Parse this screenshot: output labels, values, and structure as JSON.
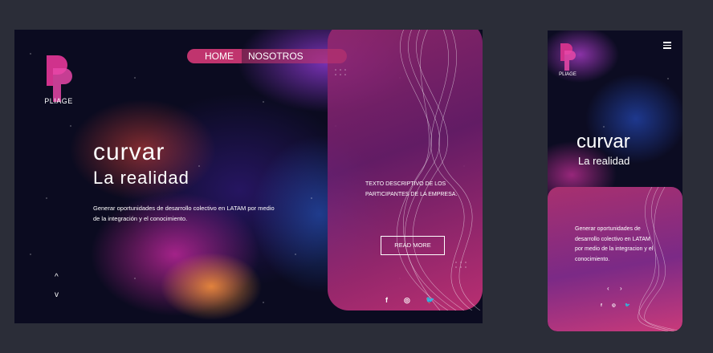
{
  "desktop": {
    "logo_text": "PLIAGE",
    "nav": {
      "home": "HOME",
      "nosotros": "NOSOTROS"
    },
    "headline_1": "curvar",
    "headline_2": "La realidad",
    "description": "Generar oportunidades de desarrollo colectivo en LATAM por medio de la integración y el conocimiento.",
    "panel_text": "TEXTO DESCRIPTIVO DE LOS PARTICIPANTES DE LA EMPRESA.",
    "read_more": "READ MORE",
    "arrow_up": "^",
    "arrow_down": "v",
    "social": {
      "facebook": "f",
      "instagram": "◎",
      "twitter": "🐦"
    }
  },
  "mobile": {
    "logo_text": "PLIAGE",
    "headline_1": "curvar",
    "headline_2": "La realidad",
    "description": "Generar oportunidades de desarrollo colectivo en LATAM por medio de la integracion y el conocimiento.",
    "prev": "‹",
    "next": "›",
    "social": {
      "facebook": "f",
      "instagram": "◎",
      "twitter": "🐦"
    }
  },
  "colors": {
    "accent": "#c0346e",
    "background": "#2b2d38",
    "panel": "#9a2f7a"
  }
}
